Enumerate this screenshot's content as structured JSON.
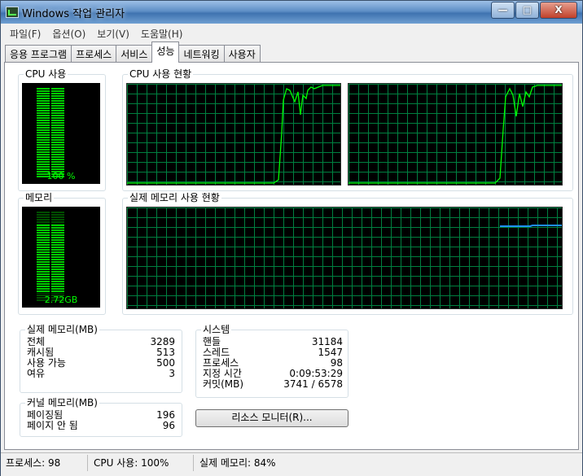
{
  "window": {
    "title": "Windows 작업 관리자",
    "minimize": "—",
    "maximize": "□",
    "close": "X"
  },
  "menu": [
    "파일(F)",
    "옵션(O)",
    "보기(V)",
    "도움말(H)"
  ],
  "tabs": [
    "응용 프로그램",
    "프로세스",
    "서비스",
    "성능",
    "네트워킹",
    "사용자"
  ],
  "active_tab": "성능",
  "cpu_usage": {
    "label": "CPU 사용",
    "value": "100 %",
    "level": 1.0
  },
  "cpu_history": {
    "label": "CPU 사용 현황"
  },
  "memory": {
    "label": "메모리",
    "value": "2.72GB",
    "level": 0.84
  },
  "memory_history": {
    "label": "실제 메모리 사용 현황"
  },
  "physical_memory": {
    "label": "실제 메모리(MB)",
    "rows": [
      {
        "name": "전체",
        "value": "3289"
      },
      {
        "name": "캐시됨",
        "value": "513"
      },
      {
        "name": "사용 가능",
        "value": "500"
      },
      {
        "name": "여유",
        "value": "3"
      }
    ]
  },
  "kernel_memory": {
    "label": "커널 메모리(MB)",
    "rows": [
      {
        "name": "페이징됨",
        "value": "196"
      },
      {
        "name": "페이지 안 됨",
        "value": "96"
      }
    ]
  },
  "system": {
    "label": "시스템",
    "rows": [
      {
        "name": "핸들",
        "value": "31184"
      },
      {
        "name": "스레드",
        "value": "1547"
      },
      {
        "name": "프로세스",
        "value": "98"
      },
      {
        "name": "지정 시간",
        "value": "0:09:53:29"
      },
      {
        "name": "커밋(MB)",
        "value": "3741 / 6578"
      }
    ]
  },
  "resource_monitor_button": "리소스 모니터(R)...",
  "status": {
    "processes": "프로세스: 98",
    "cpu": "CPU 사용: 100%",
    "memory": "실제 메모리: 84%"
  },
  "colors": {
    "graph_line": "#00ff00",
    "memory_line": "#1e90ff",
    "grid": "#008040"
  }
}
